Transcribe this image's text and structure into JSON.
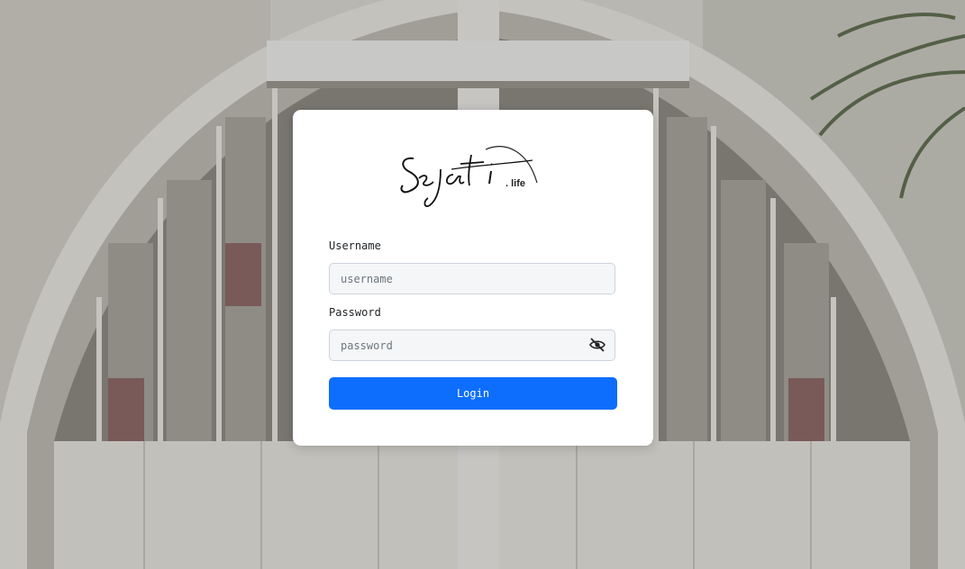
{
  "brand": {
    "logo_script": "Sejati",
    "logo_suffix": ". life"
  },
  "form": {
    "username_label": "Username",
    "username_placeholder": "username",
    "username_value": "",
    "password_label": "Password",
    "password_placeholder": "password",
    "password_value": "",
    "password_toggle_icon": "eye-slash-icon",
    "login_label": "Login"
  },
  "colors": {
    "primary": "#0d6efd",
    "card": "#ffffff",
    "field_bg": "#f5f6f8",
    "field_border": "#ced4da"
  }
}
